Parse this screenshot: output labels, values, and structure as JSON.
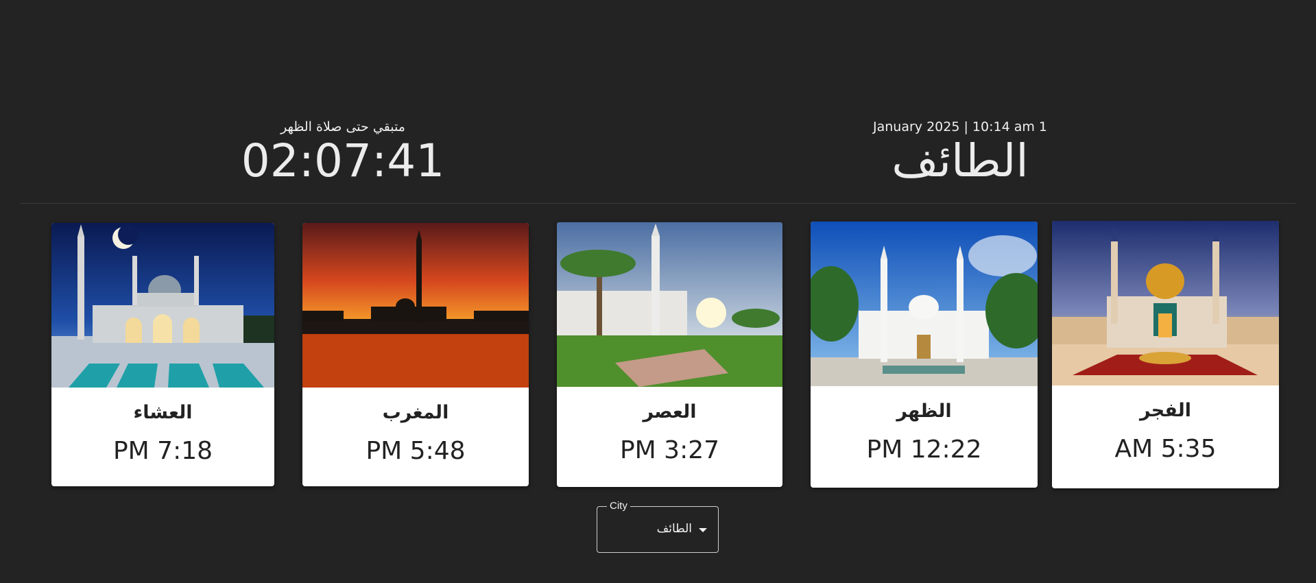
{
  "countdown": {
    "label": "متبقي حتى صلاة الظهر",
    "value": "02:07:41"
  },
  "location": {
    "datetime": "January 2025 | 10:14 am 1",
    "city": "الطائف"
  },
  "prayers": [
    {
      "name": "العشاء",
      "time": "PM 7:18",
      "icon": "mosque-night-image"
    },
    {
      "name": "المغرب",
      "time": "PM 5:48",
      "icon": "mosque-sunset-image"
    },
    {
      "name": "العصر",
      "time": "PM 3:27",
      "icon": "mosque-afternoon-image"
    },
    {
      "name": "الظهر",
      "time": "PM 12:22",
      "icon": "mosque-noon-image"
    },
    {
      "name": "الفجر",
      "time": "AM 5:35",
      "icon": "mosque-dawn-image"
    }
  ],
  "city_select": {
    "label": "City",
    "value": "الطائف"
  }
}
